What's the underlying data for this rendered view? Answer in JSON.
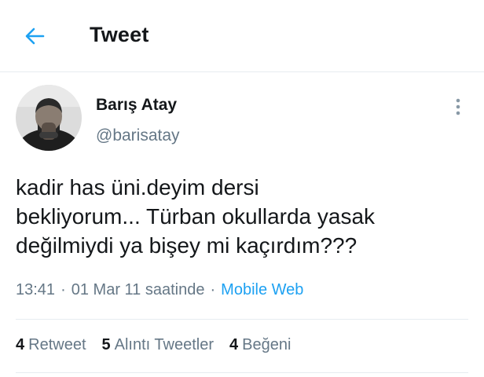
{
  "header": {
    "title": "Tweet",
    "back_icon": "arrow-left-icon",
    "accent_color": "#1da1f2"
  },
  "author": {
    "name": "Barış Atay",
    "handle": "@barisatay"
  },
  "tweet": {
    "text": "kadir has üni.deyim dersi\nbekliyorum... Türban okullarda yasak\ndeğilmiydi ya bişey mi kaçırdım???",
    "time": "13:41",
    "date": "01 Mar 11 saatinde",
    "separator": "·",
    "source": "Mobile Web"
  },
  "stats": {
    "retweets": {
      "count": "4",
      "label": "Retweet"
    },
    "quotes": {
      "count": "5",
      "label": "Alıntı Tweetler"
    },
    "likes": {
      "count": "4",
      "label": "Beğeni"
    }
  },
  "colors": {
    "text": "#14171a",
    "secondary": "#657786",
    "divider": "#e6ecf0"
  }
}
